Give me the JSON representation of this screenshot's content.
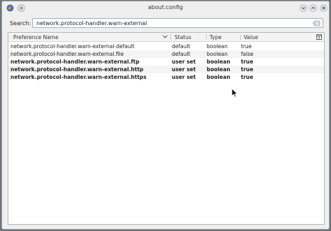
{
  "window": {
    "title": "about:config"
  },
  "search": {
    "label": "Search:",
    "value": "network.protocol-handler.warn-external"
  },
  "columns": {
    "name": "Preference Name",
    "status": "Status",
    "type": "Type",
    "value": "Value"
  },
  "rows": [
    {
      "name": "network.protocol-handler.warn-external-default",
      "status": "default",
      "type": "boolean",
      "value": "true"
    },
    {
      "name": "network.protocol-handler.warn-external.file",
      "status": "default",
      "type": "boolean",
      "value": "false"
    },
    {
      "name": "network.protocol-handler.warn-external.ftp",
      "status": "user set",
      "type": "boolean",
      "value": "true"
    },
    {
      "name": "network.protocol-handler.warn-external.http",
      "status": "user set",
      "type": "boolean",
      "value": "true"
    },
    {
      "name": "network.protocol-handler.warn-external.https",
      "status": "user set",
      "type": "boolean",
      "value": "true"
    }
  ],
  "icons": {
    "app": "firefox-icon",
    "pin": "pin-icon",
    "minimize": "chevron-down-icon",
    "maximize": "chevron-up-icon",
    "close": "close-icon",
    "clear": "clear-field-icon",
    "column_picker": "column-picker-icon",
    "sort": "sort-descending-icon",
    "cursor": "mouse-pointer-icon"
  },
  "colors": {
    "window_bg": "#efefef",
    "accent": "#3a6fb0"
  }
}
